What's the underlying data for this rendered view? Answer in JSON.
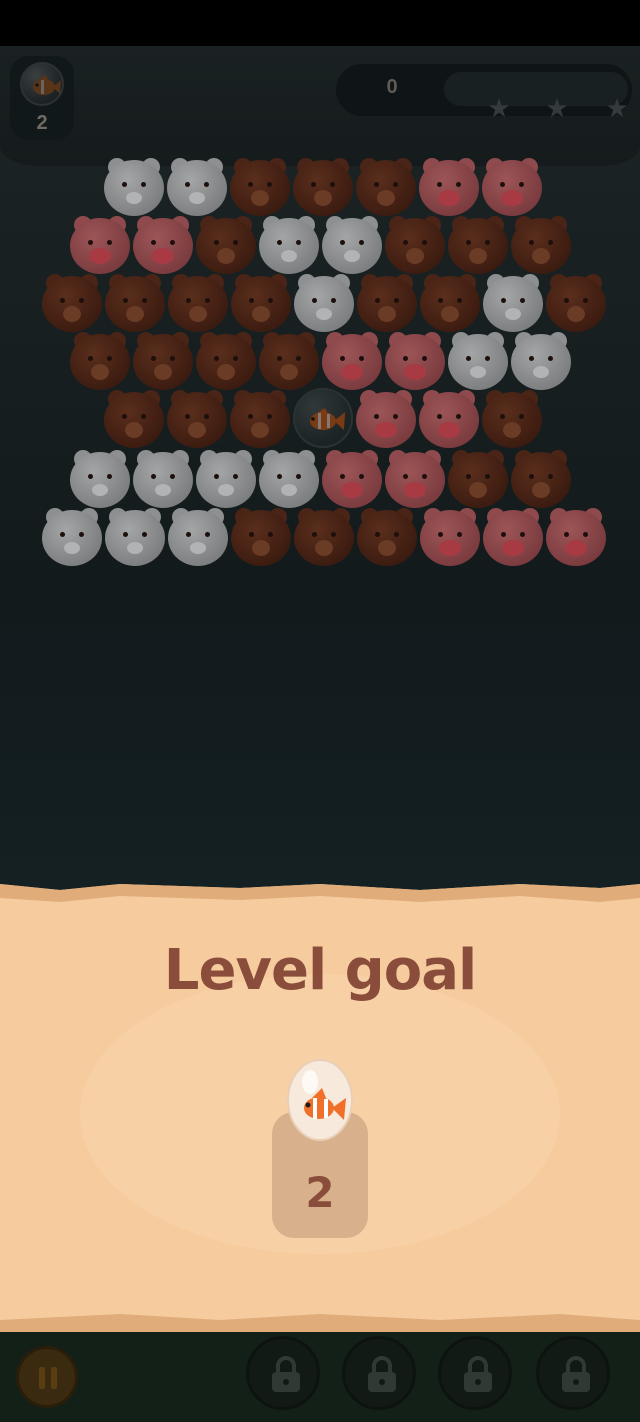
{
  "hud": {
    "goal_icon": "clownfish-icon",
    "goal_remaining": "2",
    "score": "0",
    "progress_fraction": 0,
    "stars": [
      "star-icon",
      "star-icon",
      "star-icon"
    ]
  },
  "board": {
    "bubble_kinds": [
      "pig",
      "bear",
      "polar-bear",
      "clownfish"
    ]
  },
  "modal": {
    "title": "Level goal",
    "goal_icon": "clownfish-icon",
    "goal_count": "2"
  },
  "bottom_bar": {
    "pause_icon": "pause-icon",
    "booster_slots": [
      "lock-icon",
      "lock-icon",
      "lock-icon",
      "lock-icon"
    ]
  },
  "colors": {
    "parchment": "#f6cc9f",
    "title_text": "#8a4d3c",
    "pig": "#8e4a4c",
    "bear": "#4a2416",
    "polar_bear": "#8d8f90"
  }
}
